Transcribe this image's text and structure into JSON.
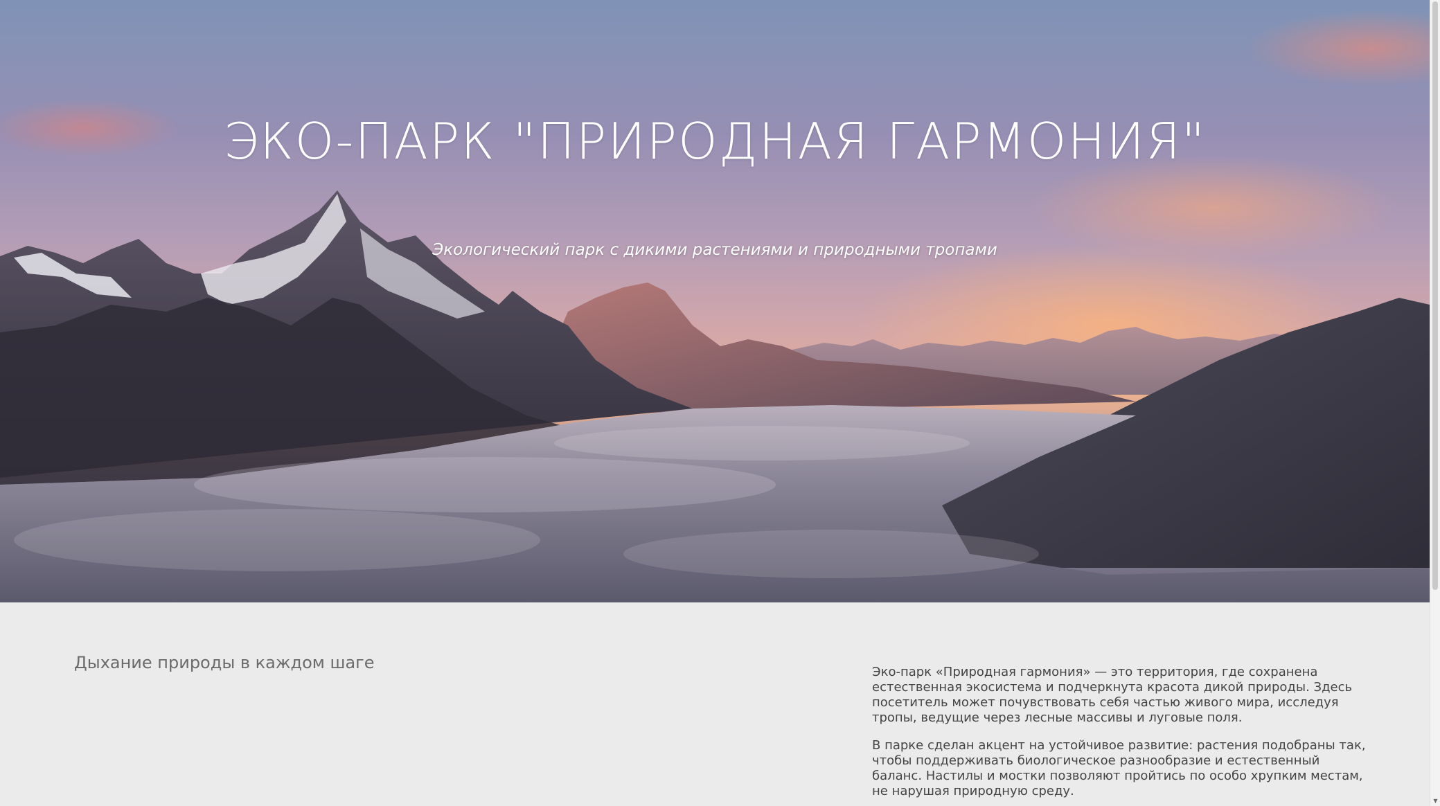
{
  "hero": {
    "title": "ЭКО-ПАРК \"ПРИРОДНАЯ ГАРМОНИЯ\"",
    "subtitle": "Экологический парк с дикими растениями и природными тропами"
  },
  "about": {
    "heading": "Дыхание природы в каждом шаге",
    "paragraphs": [
      "Эко-парк «Природная гармония» — это территория, где сохранена естественная экосистема и подчеркнута красота дикой природы. Здесь посетитель может почувствовать себя частью живого мира, исследуя тропы, ведущие через лесные массивы и луговые поля.",
      "В парке сделан акцент на устойчивое развитие: растения подобраны так, чтобы поддерживать биологическое разнообразие и естественный баланс. Настилы и мостки позволяют пройтись по особо хрупким местам, не нарушая природную среду."
    ]
  },
  "scrollbar": {
    "up_arrow_icon": "chevron-up-icon",
    "down_arrow_icon": "chevron-down-icon",
    "up_glyph": "▲",
    "down_glyph": "▼"
  },
  "colors": {
    "background": "#ebebeb",
    "heading_text": "#6b6b6b",
    "body_text": "#444444",
    "hero_text": "#ffffff"
  }
}
